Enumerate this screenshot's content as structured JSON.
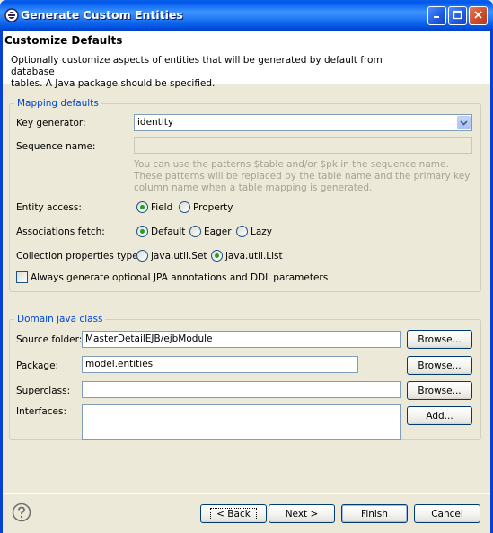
{
  "window": {
    "title": "Generate Custom Entities"
  },
  "header": {
    "title": "Customize Defaults",
    "description_line1": "Optionally customize aspects of entities that will be generated by default from database",
    "description_line2": "tables. A Java package should be specified."
  },
  "mapping": {
    "legend": "Mapping defaults",
    "key_generator_label": "Key generator:",
    "key_generator_value": "identity",
    "sequence_name_label": "Sequence name:",
    "sequence_name_value": "",
    "hint_line1": "You can use the patterns $table and/or $pk in the sequence name.",
    "hint_line2": "These patterns will be replaced by the table name and the primary key",
    "hint_line3": "column name when a table mapping is generated.",
    "entity_access_label": "Entity access:",
    "entity_access_options": [
      "Field",
      "Property"
    ],
    "entity_access_selected": "Field",
    "associations_fetch_label": "Associations fetch:",
    "associations_fetch_options": [
      "Default",
      "Eager",
      "Lazy"
    ],
    "associations_fetch_selected": "Default",
    "collection_type_label": "Collection properties type:",
    "collection_type_options": [
      "java.util.Set",
      "java.util.List"
    ],
    "collection_type_selected": "java.util.List",
    "always_generate_label": "Always generate optional JPA annotations and DDL parameters",
    "always_generate_checked": false
  },
  "domain": {
    "legend": "Domain java class",
    "source_folder_label": "Source folder:",
    "source_folder_value": "MasterDetailEJB/ejbModule",
    "package_label": "Package:",
    "package_value": "model.entities",
    "superclass_label": "Superclass:",
    "superclass_value": "",
    "interfaces_label": "Interfaces:",
    "browse_label": "Browse...",
    "add_label": "Add..."
  },
  "footer": {
    "back_label": "< Back",
    "next_label": "Next >",
    "finish_label": "Finish",
    "cancel_label": "Cancel"
  },
  "colors": {
    "accent": "#0046D5",
    "titlebar": "#0054E3",
    "dialog_bg": "#ECE9D8",
    "radio_selected": "#21A121"
  },
  "icons": [
    "eclipse-icon",
    "minimize-icon",
    "maximize-icon",
    "close-icon",
    "help-icon",
    "dropdown-arrow-icon"
  ]
}
